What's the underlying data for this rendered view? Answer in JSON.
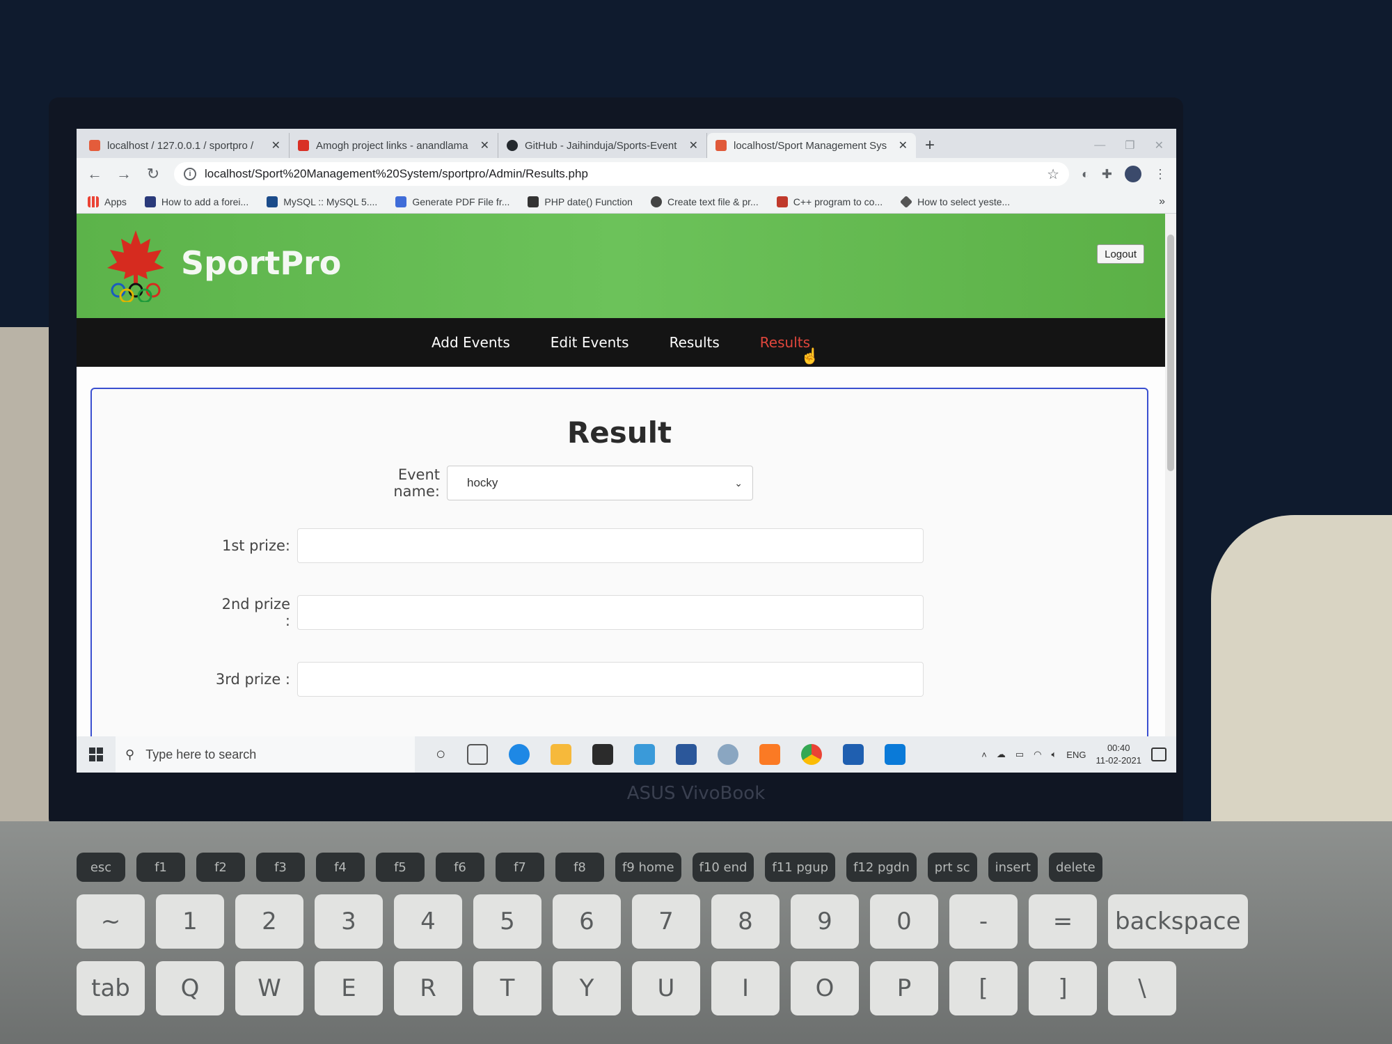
{
  "browser": {
    "tabs": [
      {
        "title": "localhost / 127.0.0.1 / sportpro /",
        "favicon_color": "#e45c3b",
        "active": false
      },
      {
        "title": "Amogh project links - anandlama",
        "favicon_color": "#d93025",
        "active": false
      },
      {
        "title": "GitHub - Jaihinduja/Sports-Event",
        "favicon_color": "#24292e",
        "active": false
      },
      {
        "title": "localhost/Sport Management Sys",
        "favicon_color": "#e05a3a",
        "active": true
      }
    ],
    "tab_close_glyph": "✕",
    "new_tab_glyph": "+",
    "url": "localhost/Sport%20Management%20System/sportpro/Admin/Results.php",
    "bookmarks": [
      {
        "label": "Apps",
        "icon_color": "#ea4335"
      },
      {
        "label": "How to add a forei...",
        "icon_color": "#2a3a7a"
      },
      {
        "label": "MySQL :: MySQL 5....",
        "icon_color": "#1b4b8a"
      },
      {
        "label": "Generate PDF File fr...",
        "icon_color": "#3f6cd8"
      },
      {
        "label": "PHP date() Function",
        "icon_color": "#333333"
      },
      {
        "label": "Create text file & pr...",
        "icon_color": "#444444"
      },
      {
        "label": "C++ program to co...",
        "icon_color": "#c0392b"
      },
      {
        "label": "How to select yeste...",
        "icon_color": "#555555"
      }
    ],
    "bookmarks_more": "»"
  },
  "site": {
    "title": "SportPro",
    "logout_label": "Logout",
    "nav": [
      {
        "label": "Add Events",
        "active": false
      },
      {
        "label": "Edit Events",
        "active": false
      },
      {
        "label": "Results",
        "active": false
      },
      {
        "label": "Results",
        "active": true
      }
    ],
    "accent_green": "#5cb34a",
    "nav_active_color": "#e0463c"
  },
  "form": {
    "heading": "Result",
    "event_label": "Event name:",
    "event_value": "hocky",
    "prize1_label": "1st prize:",
    "prize2_label": "2nd prize :",
    "prize3_label": "3rd prize :"
  },
  "taskbar": {
    "search_placeholder": "Type here to search",
    "apps": [
      {
        "name": "cortana-icon",
        "color": "#444444"
      },
      {
        "name": "task-view-icon",
        "color": "#555555"
      },
      {
        "name": "edge-icon",
        "color": "#1e88e5"
      },
      {
        "name": "file-explorer-icon",
        "color": "#f6b93b"
      },
      {
        "name": "mail-icon",
        "color": "#2b2b2b"
      },
      {
        "name": "photos-icon",
        "color": "#3a9ad9"
      },
      {
        "name": "word-icon",
        "color": "#2b579a"
      },
      {
        "name": "paint-icon",
        "color": "#8aa6c1"
      },
      {
        "name": "xampp-icon",
        "color": "#fb7a24"
      },
      {
        "name": "chrome-icon",
        "color": "#34a853"
      },
      {
        "name": "powershell-icon",
        "color": "#1f5fb0"
      },
      {
        "name": "vscode-icon",
        "color": "#0a7ad8"
      }
    ],
    "language": "ENG",
    "time": "00:40",
    "date": "11-02-2021"
  },
  "device": {
    "brand": "ASUS VivoBook",
    "top_keys": [
      "esc",
      "f1",
      "f2",
      "f3",
      "f4",
      "f5",
      "f6",
      "f7",
      "f8",
      "f9 home",
      "f10 end",
      "f11 pgup",
      "f12 pgdn",
      "prt sc",
      "insert",
      "delete"
    ],
    "number_keys": [
      "~",
      "1",
      "2",
      "3",
      "4",
      "5",
      "6",
      "7",
      "8",
      "9",
      "0",
      "-",
      "=",
      "backspace"
    ],
    "letter_keys": [
      "tab",
      "Q",
      "W",
      "E",
      "R",
      "T",
      "Y",
      "U",
      "I",
      "O",
      "P",
      "[",
      "]",
      "\\"
    ]
  }
}
